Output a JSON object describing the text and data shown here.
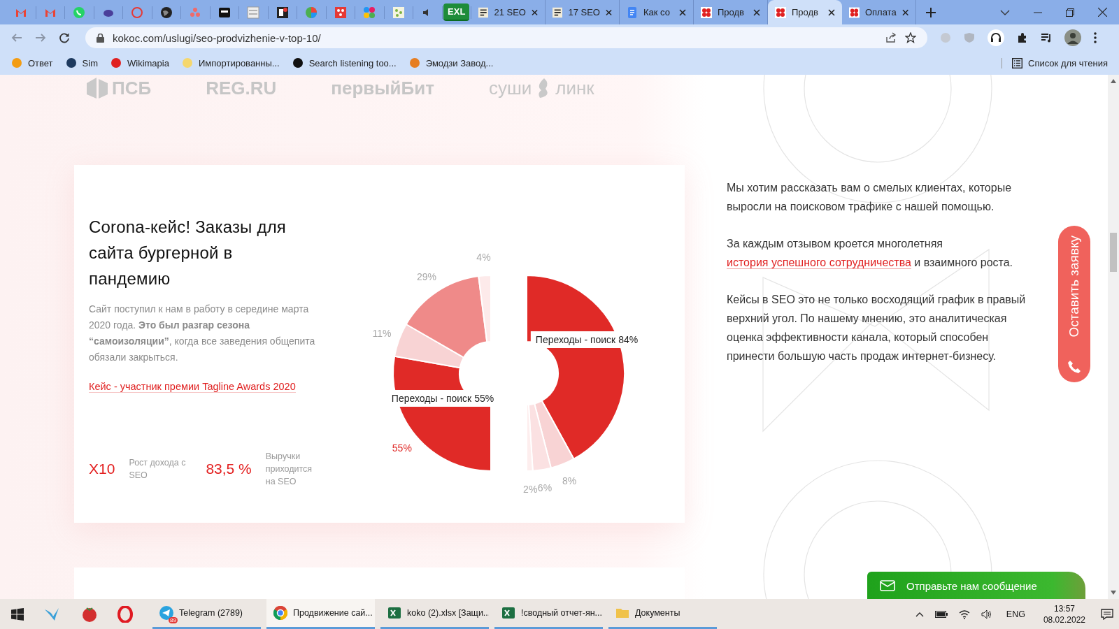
{
  "browser": {
    "pinned_label": "EXL",
    "tabs": [
      {
        "title": "21 SEO",
        "selected": false
      },
      {
        "title": "17 SEO",
        "selected": false
      },
      {
        "title": "Как со",
        "selected": false
      },
      {
        "title": "Продв",
        "selected": false
      },
      {
        "title": "Продв",
        "selected": true
      },
      {
        "title": "Оплата",
        "selected": false
      }
    ],
    "url": "kokoc.com/uslugi/seo-prodvizhenie-v-top-10/",
    "bookmarks": [
      "Ответ",
      "Sim",
      "Wikimapia",
      "Импортированны...",
      "Search listening too...",
      "Эмодзи Завод..."
    ],
    "reading_list": "Список для чтения"
  },
  "page": {
    "partner_logos": [
      {
        "words": [
          "ПСБ"
        ]
      },
      {
        "words": [
          "REG.RU"
        ]
      },
      {
        "words": [
          "первыйБит"
        ]
      },
      {
        "words": [
          "суши",
          "линк"
        ]
      }
    ],
    "case": {
      "title": "Corona-кейс! Заказы для сайта бургерной в пандемию",
      "text": "Сайт поступил к нам в работу в середине марта 2020 года. **Это был разгар сезона “самоизоляции”**, когда все заведения общепита обязали закрыться.",
      "link": "Кейс - участник премии Tagline Awards 2020",
      "stats": [
        {
          "value": "X10",
          "label": "Рост дохода с SEO"
        },
        {
          "value": "83,5 %",
          "label": "Выручки приходится на SEO"
        }
      ],
      "charts": [
        {
          "chart_data": {
            "type": "donut",
            "data_labels": true,
            "series": [
              {
                "name": "Переходы - поиск 55%",
                "values": [
                  55,
                  11,
                  29,
                  4
                ],
                "colors": [
                  "#e02a27",
                  "#f8d3d4",
                  "#ef8a89",
                  "#fdeaea"
                ],
                "value_labels": [
                  "55%",
                  "11%",
                  "29%",
                  "4%"
                ]
              }
            ]
          }
        },
        {
          "chart_data": {
            "type": "donut",
            "data_labels": true,
            "series": [
              {
                "name": "Переходы - поиск 84%",
                "values": [
                  84,
                  8,
                  6,
                  2
                ],
                "colors": [
                  "#e02a27",
                  "#f8d3d4",
                  "#fbe1e2",
                  "#fdeeee"
                ],
                "value_labels": [
                  null,
                  "8%",
                  "6%",
                  "2%"
                ]
              }
            ]
          }
        }
      ]
    },
    "intro": {
      "first": "Мы хотим рассказать вам о смелых клиентах, которые выросли на поисковом трафике с нашей помощью.",
      "second": {
        "before": "За каждым отзывом кроется многолетняя ",
        "link": "история успешного сотрудничества",
        "after": " и взаимного роста."
      },
      "third": "Кейсы в SEO это не только восходящий график в правый верхний угол. По нашему мнению, это аналитическая оценка эффективности канала, который способен принести большую часть продаж интернет-бизнесу."
    },
    "side_button": "Оставить заявку",
    "chat_button": "Отправьте нам сообщение"
  },
  "taskbar": {
    "apps": [
      {
        "title": "Telegram (2789)",
        "badge": "89",
        "selected": false
      },
      {
        "title": "Продвижение сай...",
        "selected": true
      },
      {
        "title": "koko (2).xlsx  [Защи...",
        "selected": false
      },
      {
        "title": "!сводный отчет-ян...",
        "selected": false
      },
      {
        "title": "Документы",
        "selected": false
      }
    ],
    "language": "ENG",
    "time": "13:57",
    "date": "08.02.2022"
  }
}
